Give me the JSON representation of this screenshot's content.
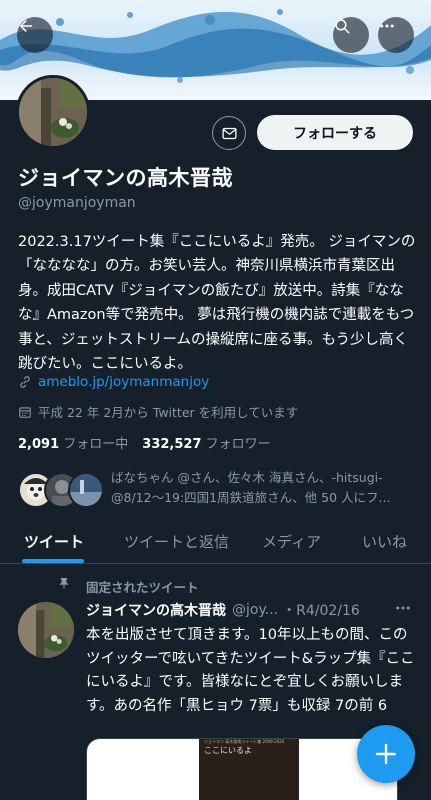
{
  "header": {
    "back_icon": "back-arrow-icon",
    "search_icon": "search-icon",
    "more_icon": "more-horizontal-icon"
  },
  "profile": {
    "display_name": "ジョイマンの高木晋哉",
    "handle": "@joymanjoyman",
    "message_icon": "envelope-icon",
    "follow_label": "フォローする",
    "bio": "2022.3.17ツイート集『ここにいるよ』発売。 ジョイマンの「なななな」の方。お笑い芸人。神奈川県横浜市青葉区出身。成田CATV『ジョイマンの飯たび』放送中。詩集『ななな』Amazon等で発売中。 夢は飛行機の機内誌で連載をもつ事と、ジェットストリームの操縦席に座る事。もう少し高く跳びたい。ここにいるよ。",
    "link": "ameblo.jp/joymanmanjoy",
    "joined": "平成 22 年 2月から Twitter を利用しています",
    "following_count": "2,091",
    "following_label": "フォロー中",
    "followers_count": "332,527",
    "followers_label": "フォロワー",
    "followers_you_know": "ばなちゃん @さん、佐々木 海真さん、-hitsugi- @8/12〜19:四国1周鉄道旅さん、他 50 人にフ..."
  },
  "tabs": [
    {
      "label": "ツイート",
      "active": true
    },
    {
      "label": "ツイートと返信",
      "active": false
    },
    {
      "label": "メディア",
      "active": false
    },
    {
      "label": "いいね",
      "active": false
    }
  ],
  "pinned_tweet": {
    "pinned_label": "固定されたツイート",
    "name": "ジョイマンの高木晋哉",
    "handle": "@joy...",
    "date": "・R4/02/16",
    "body": "本を出版させて頂きます。10年以上もの間、このツイッターで呟いてきたツイート&ラップ集『ここにいるよ』です。皆様なにとぞ宜しくお願いします。あの名作「黒ヒョウ 7票」も収録 7の前 6",
    "book_title": "ここにいるよ",
    "book_series": "ジョイマン 高木晋哉ツイート集 2009-2020"
  },
  "fab": {
    "icon": "plus-icon"
  },
  "colors": {
    "background": "#15202b",
    "accent": "#1d9bf0",
    "secondary_text": "#8899a6",
    "follow_button": "#eff3f4"
  }
}
